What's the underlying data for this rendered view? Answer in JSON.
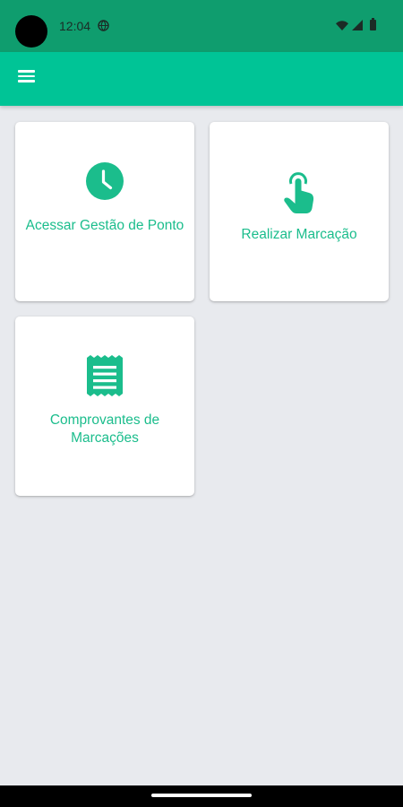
{
  "status_bar": {
    "time": "12:04",
    "icons": [
      "globe-icon",
      "wifi-icon",
      "cellular-signal-icon",
      "battery-icon"
    ]
  },
  "app_bar": {
    "menu_icon": "hamburger-menu-icon"
  },
  "cards": [
    {
      "label": "Acessar Gestão de Ponto",
      "icon": "clock-icon"
    },
    {
      "label": "Realizar Marcação",
      "icon": "touch-hand-icon"
    },
    {
      "label": "Comprovantes de Marcações",
      "icon": "receipt-icon"
    }
  ],
  "colors": {
    "status_bar": "#0f9d6e",
    "app_bar": "#00c496",
    "accent": "#1bbd8c",
    "background": "#e8eaee",
    "card": "#ffffff"
  }
}
